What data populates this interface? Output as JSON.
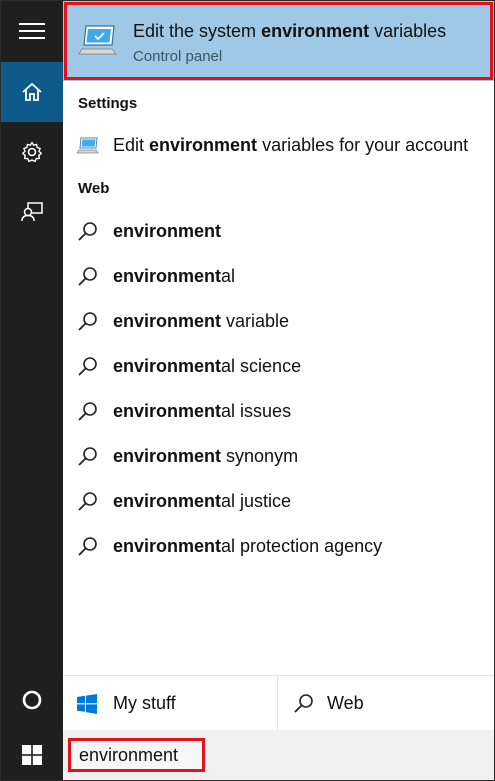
{
  "top_hit": {
    "title_pre": "Edit the system ",
    "title_bold": "environment",
    "title_post": " variables",
    "subtitle": "Control panel",
    "icon": "monitor-settings-icon"
  },
  "sections": {
    "settings_label": "Settings",
    "web_label": "Web"
  },
  "settings_result": {
    "pre": "Edit ",
    "bold": "environment",
    "post": " variables for your account",
    "icon": "settings-monitor-icon"
  },
  "web_results": [
    {
      "bold": "environment",
      "rest": ""
    },
    {
      "bold": "environment",
      "rest": "al"
    },
    {
      "bold": "environment",
      "rest": " variable"
    },
    {
      "bold": "environment",
      "rest": "al science"
    },
    {
      "bold": "environment",
      "rest": "al issues"
    },
    {
      "bold": "environment",
      "rest": " synonym"
    },
    {
      "bold": "environment",
      "rest": "al justice"
    },
    {
      "bold": "environment",
      "rest": "al protection agency"
    }
  ],
  "bottom_tabs": {
    "my_stuff": "My stuff",
    "web": "Web"
  },
  "taskbar": {
    "search_value": "environment"
  },
  "colors": {
    "rail": "#1f1f1f",
    "rail_active": "#0e5a8a",
    "top_hit_bg": "#9ec8e6",
    "highlight_outline": "#e1121c",
    "windows_blue": "#0078d7"
  }
}
